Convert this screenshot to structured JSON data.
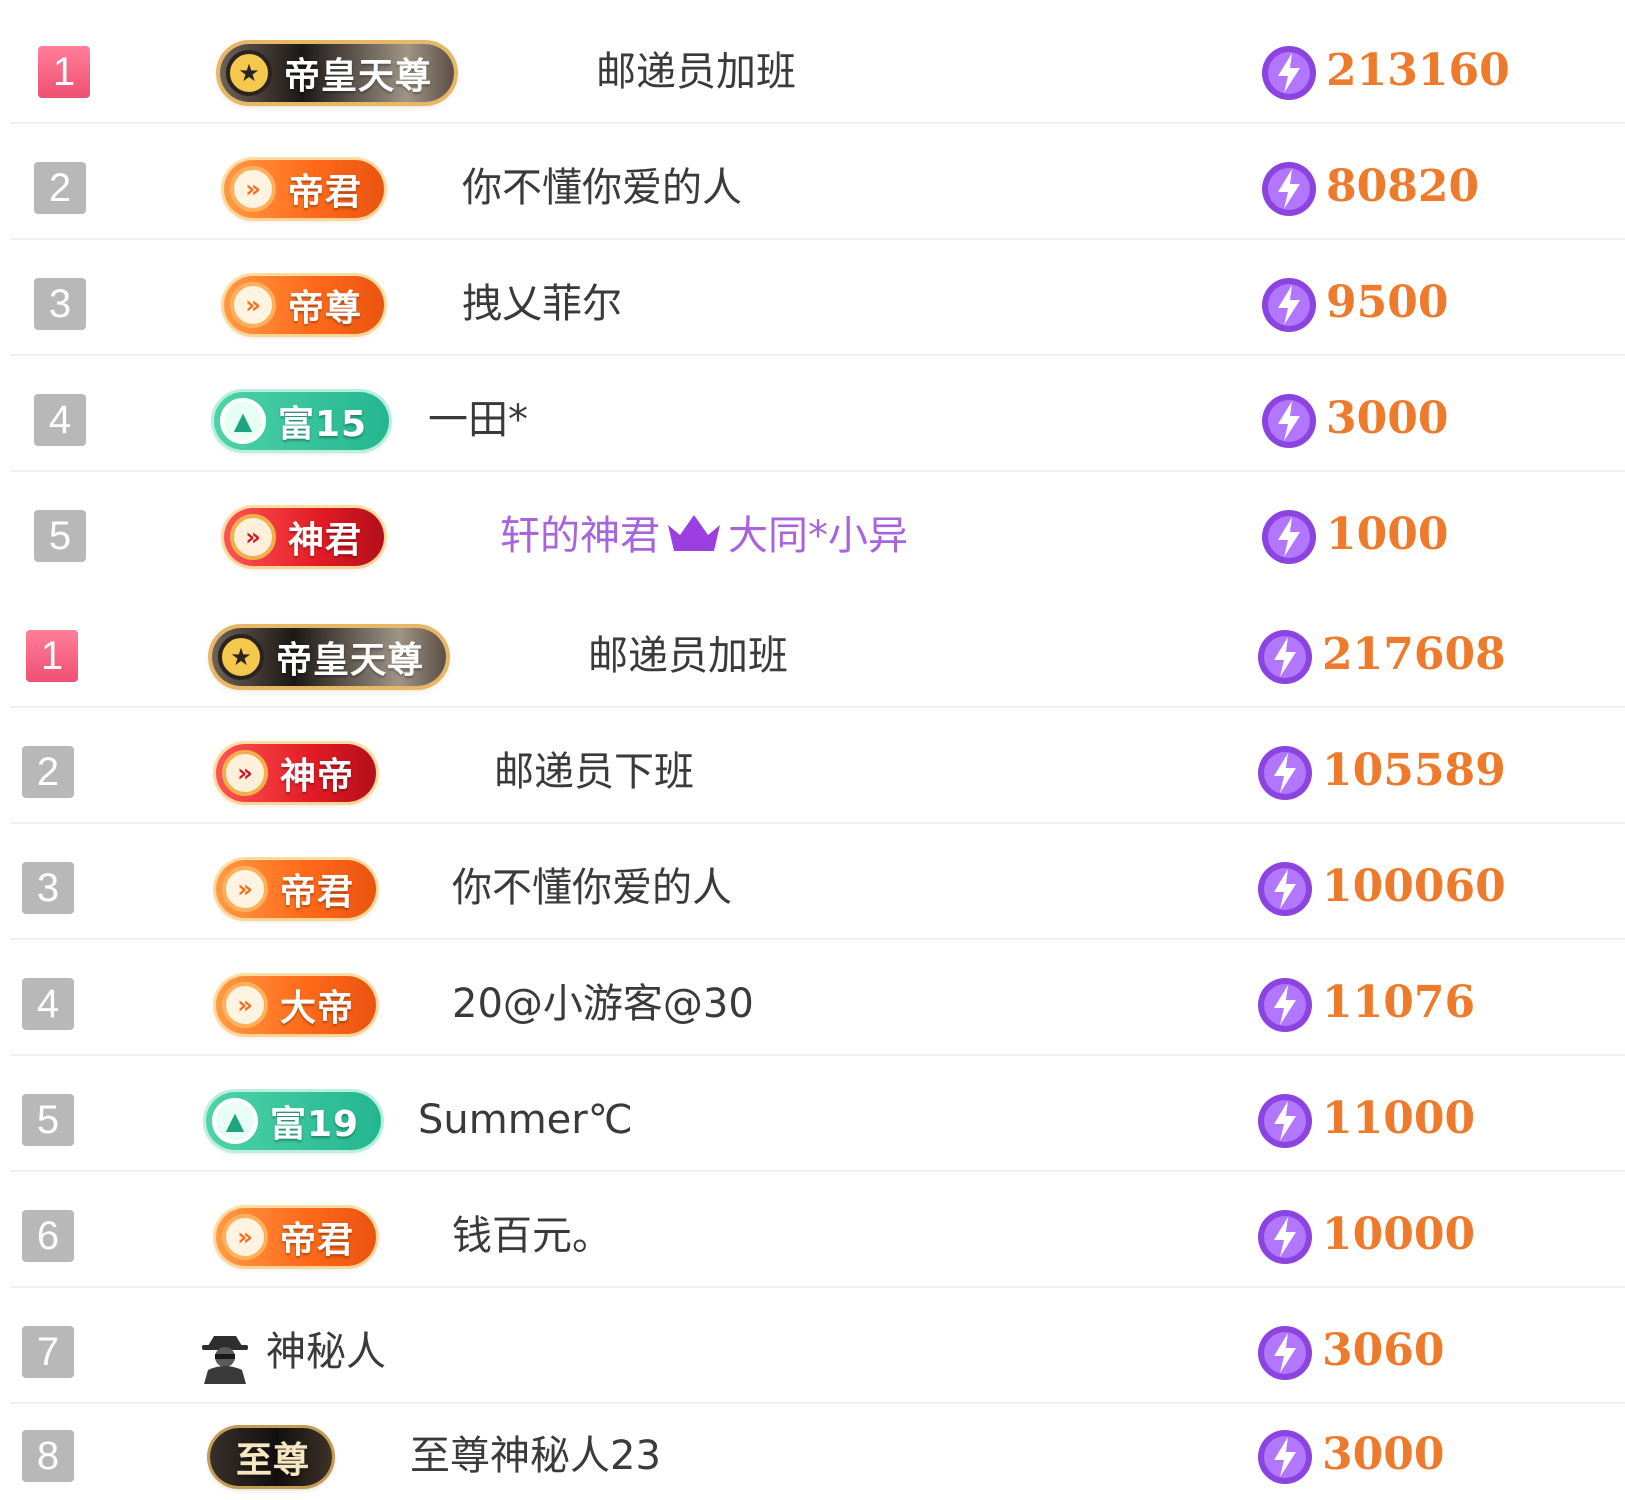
{
  "board1": {
    "rows": [
      {
        "rank": "1",
        "badge": "帝皇天尊",
        "name": "邮递员加班",
        "score": "213160"
      },
      {
        "rank": "2",
        "badge": "帝君",
        "name": "你不懂你爱的人",
        "score": "80820"
      },
      {
        "rank": "3",
        "badge": "帝尊",
        "name": "拽乂菲尔",
        "score": "9500"
      },
      {
        "rank": "4",
        "badge": "富15",
        "name": "一田*",
        "score": "3000"
      },
      {
        "rank": "5",
        "badge": "神君",
        "name_prefix": "轩的神君",
        "name_suffix": "大同*小异",
        "score": "1000"
      }
    ]
  },
  "board2": {
    "rows": [
      {
        "rank": "1",
        "badge": "帝皇天尊",
        "name": "邮递员加班",
        "score": "217608"
      },
      {
        "rank": "2",
        "badge": "神帝",
        "name": "邮递员下班",
        "score": "105589"
      },
      {
        "rank": "3",
        "badge": "帝君",
        "name": "你不懂你爱的人",
        "score": "100060"
      },
      {
        "rank": "4",
        "badge": "大帝",
        "name": "20@小游客@30",
        "score": "11076"
      },
      {
        "rank": "5",
        "badge": "富19",
        "name": "Summer℃",
        "score": "11000"
      },
      {
        "rank": "6",
        "badge": "帝君",
        "name": "钱百元。",
        "score": "10000"
      },
      {
        "rank": "7",
        "name": "神秘人",
        "score": "3060"
      },
      {
        "rank": "8",
        "badge": "至尊",
        "name": "至尊神秘人23",
        "score": "3000"
      }
    ]
  },
  "icons": {
    "star": "star-icon",
    "chevron": "double-chevron-icon",
    "triangle": "triangle-icon",
    "crown": "crown-icon",
    "mystery": "mystery-person-icon",
    "coin": "lightning-coin-icon"
  },
  "colors": {
    "rank_top": "#ef4f72",
    "rank_other": "#b8b8b8",
    "score": "#ee7a2c",
    "coin": "#9b4fe0",
    "name": "#3a3a3a",
    "name_purple": "#a864dc"
  }
}
